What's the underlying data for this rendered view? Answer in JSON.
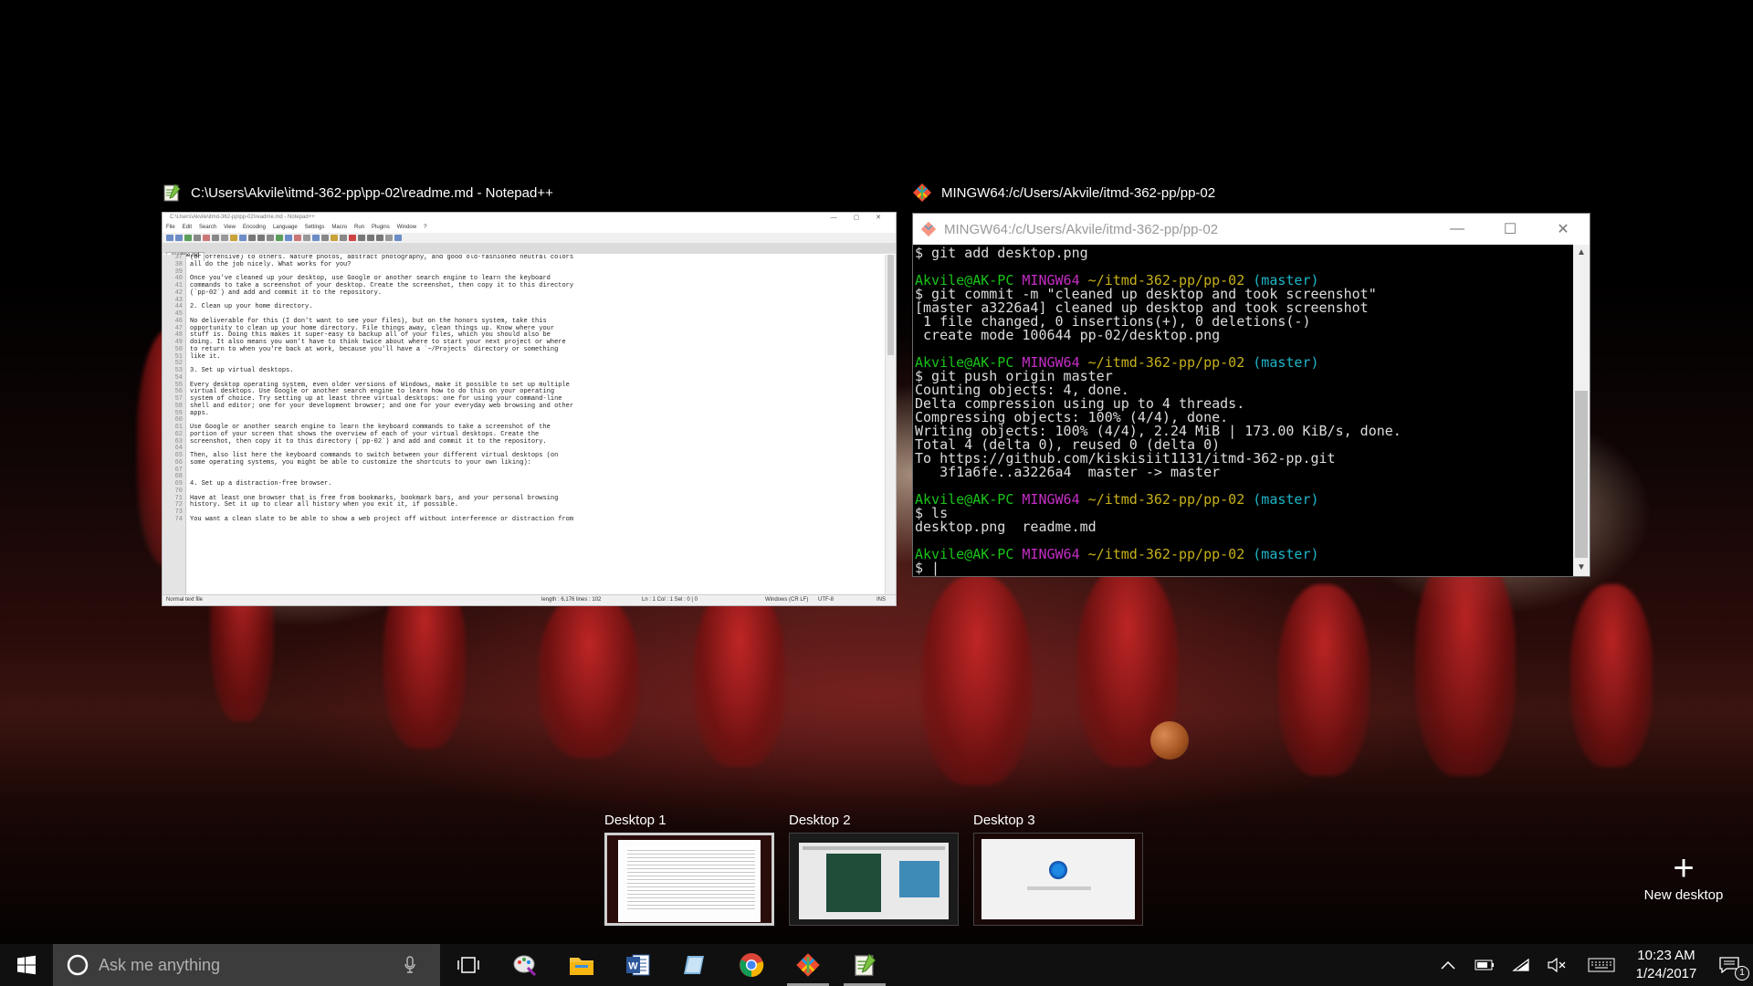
{
  "task_view": {
    "windows": [
      {
        "title": "C:\\Users\\Akvile\\itmd-362-pp\\pp-02\\readme.md - Notepad++",
        "app_icon": "notepad-plus-plus-icon"
      },
      {
        "title": "MINGW64:/c/Users/Akvile/itmd-362-pp/pp-02",
        "app_icon": "git-bash-icon"
      }
    ],
    "desktops": [
      {
        "label": "Desktop 1",
        "active": true
      },
      {
        "label": "Desktop 2",
        "active": false
      },
      {
        "label": "Desktop 3",
        "active": false
      }
    ],
    "new_desktop_label": "New desktop"
  },
  "notepad": {
    "inner_title": "C:\\Users\\Akvile\\itmd-362-pp\\pp-02\\readme.md - Notepad++",
    "menu": [
      "File",
      "Edit",
      "Search",
      "View",
      "Encoding",
      "Language",
      "Settings",
      "Macro",
      "Run",
      "Plugins",
      "Window",
      "?"
    ],
    "tab": "readme.md",
    "line_numbers": [
      "37",
      "38",
      "39",
      "40",
      "41",
      "42",
      "43",
      "44",
      "45",
      "46",
      "47",
      "48",
      "49",
      "50",
      "51",
      "52",
      "53",
      "54",
      "55",
      "56",
      "57",
      "58",
      "59",
      "60",
      "61",
      "62",
      "63",
      "64",
      "65",
      "66",
      "67",
      "68",
      "69",
      "70",
      "71",
      "72",
      "73",
      "74"
    ],
    "lines": [
      "(or offensive) to others. Nature photos, abstract photography, and good old-fashioned neutral colors",
      "all do the job nicely. What works for you?",
      "",
      "Once you've cleaned up your desktop, use Google or another search engine to learn the keyboard",
      "commands to take a screenshot of your desktop. Create the screenshot, then copy it to this directory",
      "(`pp-02`) and add and commit it to the repository.",
      "",
      "2. Clean up your home directory.",
      "",
      "No deliverable for this (I don't want to see your files), but on the honors system, take this",
      "opportunity to clean up your home directory. File things away, clean things up. Know where your",
      "stuff is. Doing this makes it super-easy to backup all of your files, which you should also be",
      "doing. It also means you won't have to think twice about where to start your next project or where",
      "to return to when you're back at work, because you'll have a `~/Projects` directory or something",
      "like it.",
      "",
      "3. Set up virtual desktops.",
      "",
      "Every desktop operating system, even older versions of Windows, make it possible to set up multiple",
      "virtual desktops. Use Google or another search engine to learn how to do this on your operating",
      "system of choice. Try setting up at least three virtual desktops: one for using your command-line",
      "shell and editor; one for your development browser; and one for your everyday web browsing and other",
      "apps.",
      "",
      "Use Google or another search engine to learn the keyboard commands to take a screenshot of the",
      "portion of your screen that shows the overview of each of your virtual desktops. Create the",
      "screenshot, then copy it to this directory (`pp-02`) and add and commit it to the repository.",
      "",
      "Then, also list here the keyboard commands to switch between your different virtual desktops (on",
      "some operating systems, you might be able to customize the shortcuts to your own liking):",
      "",
      "",
      "4. Set up a distraction-free browser.",
      "",
      "Have at least one browser that is free from bookmarks, bookmark bars, and your personal browsing",
      "history. Set it up to clear all history when you exit it, if possible.",
      "",
      "You want a clean slate to be able to show a web project off without interference or distraction from"
    ],
    "status": {
      "type": "Normal text file",
      "length": "length : 6,176   lines : 102",
      "position": "Ln : 1   Col : 1   Sel : 0 | 0",
      "eol": "Windows (CR LF)",
      "encoding": "UTF-8",
      "mode": "INS"
    }
  },
  "terminal": {
    "title": "MINGW64:/c/Users/Akvile/itmd-362-pp/pp-02",
    "lines": [
      [
        {
          "t": "$ git add desktop.png",
          "c": ""
        }
      ],
      [
        {
          "t": "",
          "c": ""
        }
      ],
      [
        {
          "t": "Akvile@AK-PC ",
          "c": "green"
        },
        {
          "t": "MINGW64 ",
          "c": "mag"
        },
        {
          "t": "~/itmd-362-pp/pp-02 ",
          "c": "yel"
        },
        {
          "t": "(master)",
          "c": "cyan"
        }
      ],
      [
        {
          "t": "$ git commit -m \"cleaned up desktop and took screenshot\"",
          "c": ""
        }
      ],
      [
        {
          "t": "[master a3226a4] cleaned up desktop and took screenshot",
          "c": ""
        }
      ],
      [
        {
          "t": " 1 file changed, 0 insertions(+), 0 deletions(-)",
          "c": ""
        }
      ],
      [
        {
          "t": " create mode 100644 pp-02/desktop.png",
          "c": ""
        }
      ],
      [
        {
          "t": "",
          "c": ""
        }
      ],
      [
        {
          "t": "Akvile@AK-PC ",
          "c": "green"
        },
        {
          "t": "MINGW64 ",
          "c": "mag"
        },
        {
          "t": "~/itmd-362-pp/pp-02 ",
          "c": "yel"
        },
        {
          "t": "(master)",
          "c": "cyan"
        }
      ],
      [
        {
          "t": "$ git push origin master",
          "c": ""
        }
      ],
      [
        {
          "t": "Counting objects: 4, done.",
          "c": ""
        }
      ],
      [
        {
          "t": "Delta compression using up to 4 threads.",
          "c": ""
        }
      ],
      [
        {
          "t": "Compressing objects: 100% (4/4), done.",
          "c": ""
        }
      ],
      [
        {
          "t": "Writing objects: 100% (4/4), 2.24 MiB | 173.00 KiB/s, done.",
          "c": ""
        }
      ],
      [
        {
          "t": "Total 4 (delta 0), reused 0 (delta 0)",
          "c": ""
        }
      ],
      [
        {
          "t": "To https://github.com/kiskisiit1131/itmd-362-pp.git",
          "c": ""
        }
      ],
      [
        {
          "t": "   3f1a6fe..a3226a4  master -> master",
          "c": ""
        }
      ],
      [
        {
          "t": "",
          "c": ""
        }
      ],
      [
        {
          "t": "Akvile@AK-PC ",
          "c": "green"
        },
        {
          "t": "MINGW64 ",
          "c": "mag"
        },
        {
          "t": "~/itmd-362-pp/pp-02 ",
          "c": "yel"
        },
        {
          "t": "(master)",
          "c": "cyan"
        }
      ],
      [
        {
          "t": "$ ls",
          "c": ""
        }
      ],
      [
        {
          "t": "desktop.png  readme.md",
          "c": ""
        }
      ],
      [
        {
          "t": "",
          "c": ""
        }
      ],
      [
        {
          "t": "Akvile@AK-PC ",
          "c": "green"
        },
        {
          "t": "MINGW64 ",
          "c": "mag"
        },
        {
          "t": "~/itmd-362-pp/pp-02 ",
          "c": "yel"
        },
        {
          "t": "(master)",
          "c": "cyan"
        }
      ],
      [
        {
          "t": "$ |",
          "c": ""
        }
      ]
    ],
    "colors": {
      "green": "#19c319",
      "mag": "#c42ec4",
      "yel": "#c7b11a",
      "cyan": "#1db6c9"
    }
  },
  "taskbar": {
    "search_placeholder": "Ask me anything",
    "pinned": [
      {
        "name": "paint-icon",
        "running": false
      },
      {
        "name": "file-explorer-icon",
        "running": false
      },
      {
        "name": "word-icon",
        "running": false
      },
      {
        "name": "notes-icon",
        "running": false
      },
      {
        "name": "chrome-icon",
        "running": false
      },
      {
        "name": "git-bash-icon",
        "running": true
      },
      {
        "name": "notepad-plus-plus-icon",
        "running": true
      }
    ],
    "clock": {
      "time": "10:23 AM",
      "date": "1/24/2017"
    },
    "notification_count": "1"
  }
}
